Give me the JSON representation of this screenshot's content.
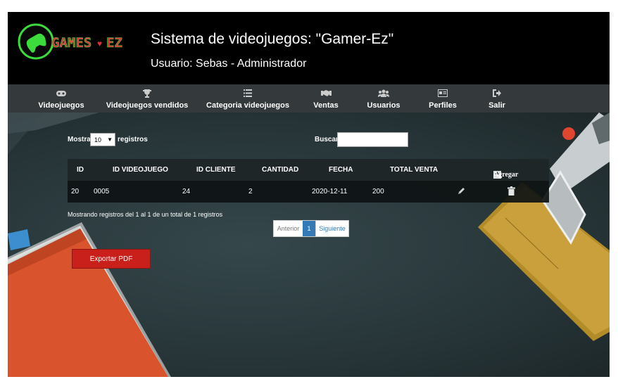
{
  "header": {
    "logo_text": "GAMES♥EZ",
    "title": "Sistema de videojuegos: \"Gamer-Ez\"",
    "subtitle": "Usuario: Sebas - Administrador"
  },
  "nav": [
    {
      "label": "Videojuegos",
      "icon": "gamepad-icon"
    },
    {
      "label": "Videojuegos vendidos",
      "icon": "trophy-icon"
    },
    {
      "label": "Categoria videojuegos",
      "icon": "list-icon"
    },
    {
      "label": "Ventas",
      "icon": "handshake-icon"
    },
    {
      "label": "Usuarios",
      "icon": "users-icon"
    },
    {
      "label": "Perfiles",
      "icon": "id-card-icon"
    },
    {
      "label": "Salir",
      "icon": "sign-out-icon"
    }
  ],
  "controls": {
    "show_label": "Mostrar",
    "show_value": "10",
    "records_label": "registros",
    "search_label": "Buscar:",
    "search_value": ""
  },
  "table": {
    "columns": [
      "ID",
      "ID VIDEOJUEGO",
      "ID CLIENTE",
      "CANTIDAD",
      "FECHA",
      "TOTAL VENTA"
    ],
    "add_label": "Agregar",
    "rows": [
      {
        "id": "20",
        "id_videojuego": "0005",
        "id_cliente": "24",
        "cantidad": "2",
        "fecha": "2020-12-11",
        "total_venta": "200"
      }
    ]
  },
  "info_text": "Mostrando registros del 1 al 1 de un total de 1 registros",
  "pagination": {
    "prev": "Anterior",
    "current": "1",
    "next": "Siguiente"
  },
  "export_label": "Exportar PDF",
  "colors": {
    "header_bg": "#000000",
    "nav_bg": "#343a3b",
    "export_red": "#c9201c",
    "page_active": "#337ab7",
    "logo_green": "#3ddc3d",
    "logo_red": "#e0303a"
  }
}
